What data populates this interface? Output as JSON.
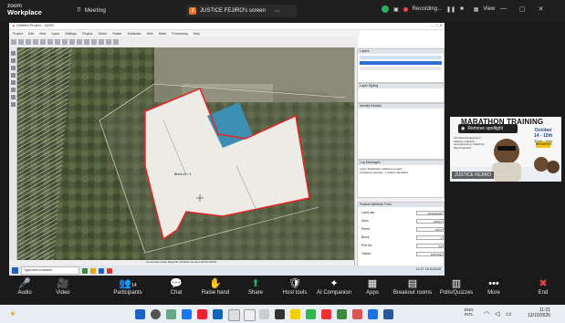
{
  "zoom": {
    "logo_line1": "zoom",
    "logo_line2": "Workplace",
    "meeting_label": "Meeting",
    "share_banner": "JUSTICE FEJIRO's screen",
    "share_initial": "J",
    "recording_label": "Recording...",
    "view_label": "View"
  },
  "qgis": {
    "window_title": "Untitled Project - QGIS",
    "menu": [
      "Project",
      "Edit",
      "View",
      "Layer",
      "Settings",
      "Plugins",
      "Vector",
      "Raster",
      "Database",
      "Web",
      "Mesh",
      "Processing",
      "Help"
    ],
    "map_label_center": "Block #1 / 4",
    "panels": {
      "layers_title": "Layers",
      "browser_title": "Layer Styling",
      "identify_title": "Identify Results",
      "log_title": "Log Messages",
      "log_line1": "Layer 'Digitization' added to project",
      "log_line2": "2 features selected - 1 feature identified",
      "form_title": "Feature Attribute Form",
      "fields": [
        {
          "label": "Land use",
          "value": "Residential"
        },
        {
          "label": "Area",
          "value": "1284.5"
        },
        {
          "label": "Perim.",
          "value": "142.3"
        },
        {
          "label": "Block",
          "value": "1"
        },
        {
          "label": "Plot No.",
          "value": "04"
        },
        {
          "label": "Owner",
          "value": "JUSTICE"
        }
      ],
      "apply_label": "Apply"
    },
    "status_text": "Coordinate  Scale  Magnifier  Rotation  Render  EPSG:32632",
    "search_placeholder": "Type here to search",
    "mini_clock": "12:27  13/10/2025"
  },
  "participant": {
    "title": "MARATHON TRAINING",
    "spotlight_label": "Remove spotlight",
    "date_line1": "October",
    "date_line2": "14 - 15th",
    "date_line3": "11am - 2pm",
    "yellow_tag": "REGISTER",
    "desc": "GIS Data Management / Attribute collection / Georeferencing / Digitizing / Map Production",
    "name": "JUSTICE FEJIRO"
  },
  "controls": [
    {
      "id": "audio",
      "label": "Audio",
      "icon": "🎤"
    },
    {
      "id": "video",
      "label": "Video",
      "icon": "🎥"
    },
    {
      "id": "participants",
      "label": "Participants",
      "icon": "👥",
      "count": "14"
    },
    {
      "id": "chat",
      "label": "Chat",
      "icon": "💬"
    },
    {
      "id": "raise-hand",
      "label": "Raise hand",
      "icon": "✋"
    },
    {
      "id": "share",
      "label": "Share",
      "icon": "⬆"
    },
    {
      "id": "host-tools",
      "label": "Host tools",
      "icon": "🛡"
    },
    {
      "id": "ai-companion",
      "label": "AI Companion",
      "icon": "✦"
    },
    {
      "id": "apps",
      "label": "Apps",
      "icon": "▦"
    },
    {
      "id": "breakout",
      "label": "Breakout rooms",
      "icon": "▤"
    },
    {
      "id": "polls",
      "label": "Polls/Quizzes",
      "icon": "▥"
    },
    {
      "id": "more",
      "label": "More",
      "icon": "•••"
    },
    {
      "id": "end",
      "label": "End",
      "icon": "✖"
    }
  ],
  "taskbar": {
    "lang_line1": "ENG",
    "lang_line2": "INTL",
    "time": "11:21",
    "date": "13/10/2025"
  }
}
